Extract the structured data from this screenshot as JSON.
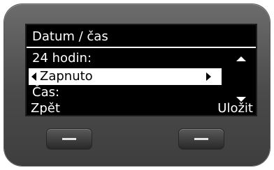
{
  "screen": {
    "title": "Datum / čas",
    "setting_label": "24 hodin:",
    "selected_value": "Zapnuto",
    "next_label": "Čas:"
  },
  "softkeys": {
    "left": "Zpět",
    "right": "Uložit"
  },
  "icons": {
    "scroll_up": "arrow-up-icon",
    "scroll_down": "arrow-down-icon",
    "value_prev": "arrow-left-icon",
    "value_next": "arrow-right-icon",
    "softkey_left_button": "dash-icon",
    "softkey_right_button": "dash-icon"
  },
  "colors": {
    "screen_bg": "#000000",
    "screen_text": "#ffffff",
    "selection_bg": "#ffffff",
    "selection_text": "#000000",
    "device_body": "#4a4a4a"
  }
}
